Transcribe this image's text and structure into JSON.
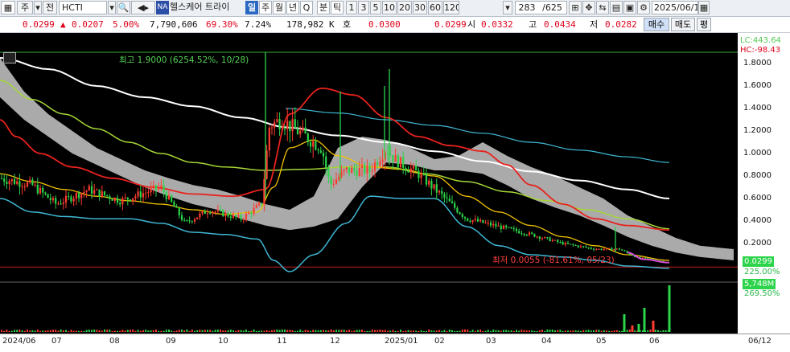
{
  "toolbar": {
    "market": "주",
    "period_select": "전",
    "symbol": "HCTI",
    "na_badge": "NA",
    "stock_name": "헬스케어 트라이",
    "periods": [
      "일",
      "주",
      "월",
      "년",
      "Q",
      "분",
      "틱"
    ],
    "intervals": [
      "1",
      "3",
      "5",
      "10",
      "20",
      "30",
      "60",
      "120"
    ],
    "page_indicator": "283",
    "page_total": "/625",
    "date": "2025/06/1"
  },
  "quote": {
    "price": "0.0299",
    "change_arrow": "▲",
    "change": "0.0207",
    "change_pct": "5.00%",
    "volume": "7,790,606",
    "volume_ratio": "69.30%",
    "turnover": "7.24%",
    "amount": "178,982 K",
    "bid_label": "호",
    "bid": "0.0300",
    "ask": "0.0299",
    "open_label": "시",
    "open": "0.0332",
    "high_label": "고",
    "high": "0.0434",
    "low_label": "저",
    "low": "0.0282",
    "buy_label": "매수",
    "sell_label": "매도",
    "eval_label": "평"
  },
  "chart": {
    "high_annotation": "최고 1.9000 (6254.52%, 10/28)",
    "low_annotation": "최저 0.0055 (-81.61%, 05/23)",
    "lc_label": "LC:443.64",
    "hc_label": "HC:-98.43",
    "y_ticks": [
      "1.8000",
      "1.6000",
      "1.4000",
      "1.2000",
      "1.0000",
      "0.8000",
      "0.6000",
      "0.4000",
      "0.2000"
    ],
    "price_tag": "0.0299",
    "price_tag_pct": "225.00%",
    "volume_tag": "5,748M",
    "volume_pct": "269.50%",
    "x_labels": [
      "2024/06",
      "07",
      "08",
      "09",
      "10",
      "11",
      "12",
      "2025/01",
      "02",
      "03",
      "04",
      "05",
      "06",
      "06/12"
    ],
    "colors": {
      "up": "#ff3b30",
      "down": "#2bd44a",
      "ma_white": "#ffffff",
      "ma_cyan": "#3fb7d4",
      "ma_yellow": "#f2c200",
      "ma_lime": "#a6d636",
      "ma_red": "#e8221e",
      "ma_magenta": "#d64fd6",
      "cloud": "#bdbdbd"
    }
  },
  "chart_data": {
    "type": "candlestick",
    "title": "",
    "y_range": [
      0,
      1.9
    ],
    "x": [
      "2024/06",
      "07",
      "08",
      "09",
      "10",
      "11",
      "12",
      "2025/01",
      "02",
      "03",
      "04",
      "05",
      "06"
    ],
    "close_approx": [
      0.78,
      0.55,
      0.66,
      0.52,
      0.55,
      1.25,
      0.9,
      0.95,
      0.7,
      0.45,
      0.28,
      0.18,
      0.03
    ],
    "high_mark": 1.9,
    "low_mark": 0.0055,
    "last_price": 0.0299
  }
}
